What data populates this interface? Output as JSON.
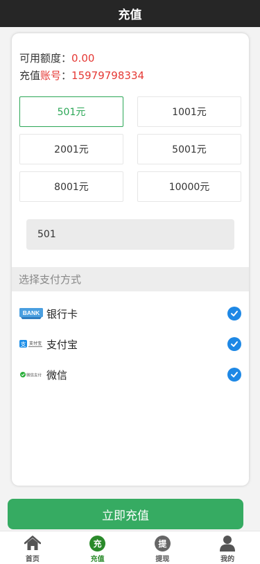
{
  "header": {
    "title": "充值"
  },
  "info": {
    "balance_label": "可用额度：",
    "balance_value": "0.00",
    "account_label_a": "充值",
    "account_label_b": "账号",
    "account_colon": "：",
    "account_value": "15979798334"
  },
  "amounts": [
    "501元",
    "1001元",
    "2001元",
    "5001元",
    "8001元",
    "10000元"
  ],
  "selected_amount": "501元",
  "custom_amount": {
    "value": "501"
  },
  "payment": {
    "section_title": "选择支付方式",
    "methods": [
      {
        "name": "银行卡",
        "logo_text": "BANK",
        "selected": true
      },
      {
        "name": "支付宝",
        "logo_text": "支付宝",
        "selected": true
      },
      {
        "name": "微信",
        "logo_text": "微信支付",
        "selected": true
      }
    ]
  },
  "submit_label": "立即充值",
  "tabbar": {
    "items": [
      {
        "label": "首页",
        "icon": "home-icon",
        "glyph": ""
      },
      {
        "label": "充值",
        "icon": "recharge-icon",
        "glyph": "充"
      },
      {
        "label": "提现",
        "icon": "withdraw-icon",
        "glyph": "提"
      },
      {
        "label": "我的",
        "icon": "user-icon",
        "glyph": ""
      }
    ],
    "active": "充值"
  },
  "colors": {
    "header_bg": "#262626",
    "accent_green": "#2aa655",
    "button_green": "#36ab62",
    "highlight_red": "#e53935",
    "check_blue": "#1e88e5"
  }
}
